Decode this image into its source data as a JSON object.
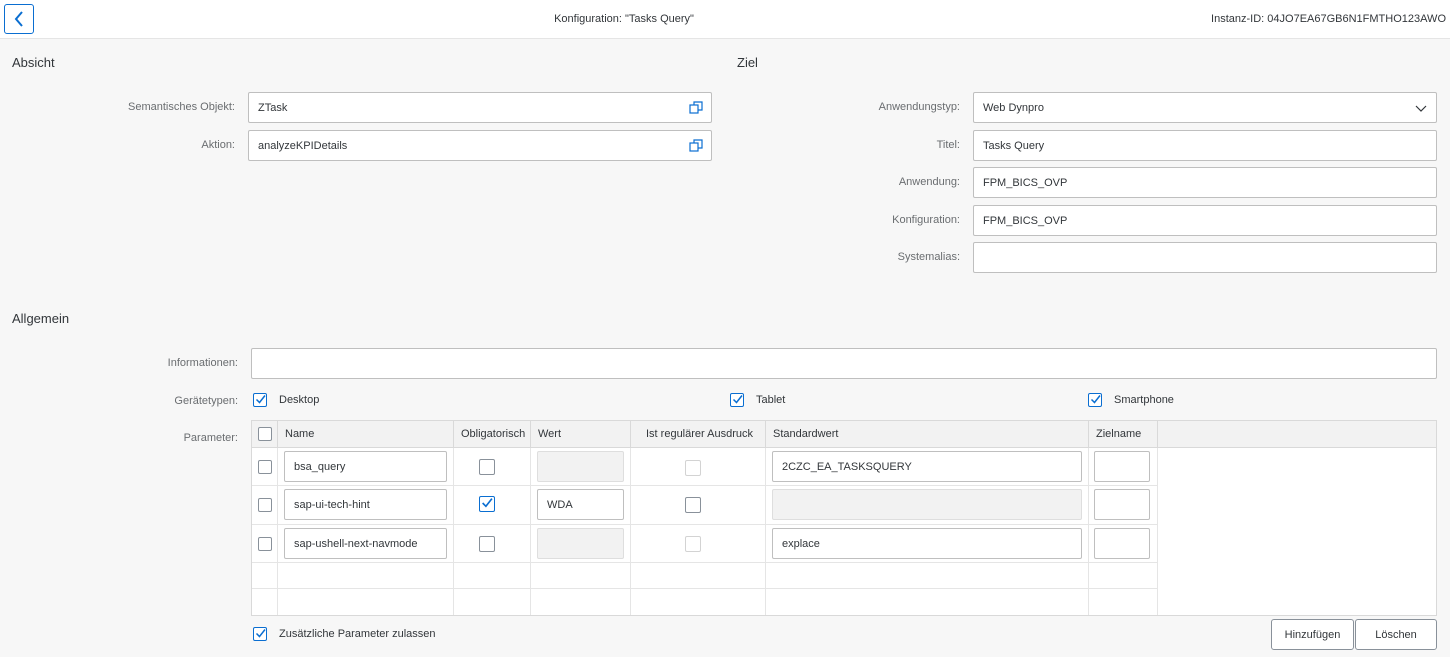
{
  "header": {
    "title": "Konfiguration: \"Tasks Query\"",
    "instance_id": "Instanz-ID: 04JO7EA67GB6N1FMTHO123AWO"
  },
  "ansicht": {
    "title": "Absicht",
    "semantic_object_label": "Semantisches Objekt:",
    "semantic_object_value": "ZTask",
    "action_label": "Aktion:",
    "action_value": "analyzeKPIDetails"
  },
  "ziel": {
    "title": "Ziel",
    "app_type_label": "Anwendungstyp:",
    "app_type_value": "Web Dynpro",
    "title_label": "Titel:",
    "title_value": "Tasks Query",
    "application_label": "Anwendung:",
    "application_value": "FPM_BICS_OVP",
    "configuration_label": "Konfiguration:",
    "configuration_value": "FPM_BICS_OVP",
    "system_alias_label": "Systemalias:",
    "system_alias_value": ""
  },
  "allgemein": {
    "title": "Allgemein",
    "info_label": "Informationen:",
    "info_value": "",
    "device_types_label": "Gerätetypen:",
    "devices": [
      {
        "label": "Desktop",
        "checked": true
      },
      {
        "label": "Tablet",
        "checked": true
      },
      {
        "label": "Smartphone",
        "checked": true
      }
    ],
    "parameters_label": "Parameter:"
  },
  "param_table": {
    "columns": [
      "Name",
      "Obligatorisch",
      "Wert",
      "Ist regulärer Ausdruck",
      "Standardwert",
      "Zielname"
    ],
    "rows": [
      {
        "name": "bsa_query",
        "mandatory": false,
        "value": "",
        "regex": false,
        "default": "2CZC_EA_TASKSQUERY",
        "target": ""
      },
      {
        "name": "sap-ui-tech-hint",
        "mandatory": true,
        "value": "WDA",
        "regex": false,
        "default": "",
        "target": ""
      },
      {
        "name": "sap-ushell-next-navmode",
        "mandatory": false,
        "value": "",
        "regex": false,
        "default": "explace",
        "target": ""
      }
    ]
  },
  "footer": {
    "additional_params_label": "Zusätzliche Parameter zulassen",
    "additional_params_checked": true,
    "add_button": "Hinzufügen",
    "delete_button": "Löschen"
  },
  "colors": {
    "accent": "#0a6ed1",
    "background": "#f7f7f7",
    "text": "#32363a"
  }
}
